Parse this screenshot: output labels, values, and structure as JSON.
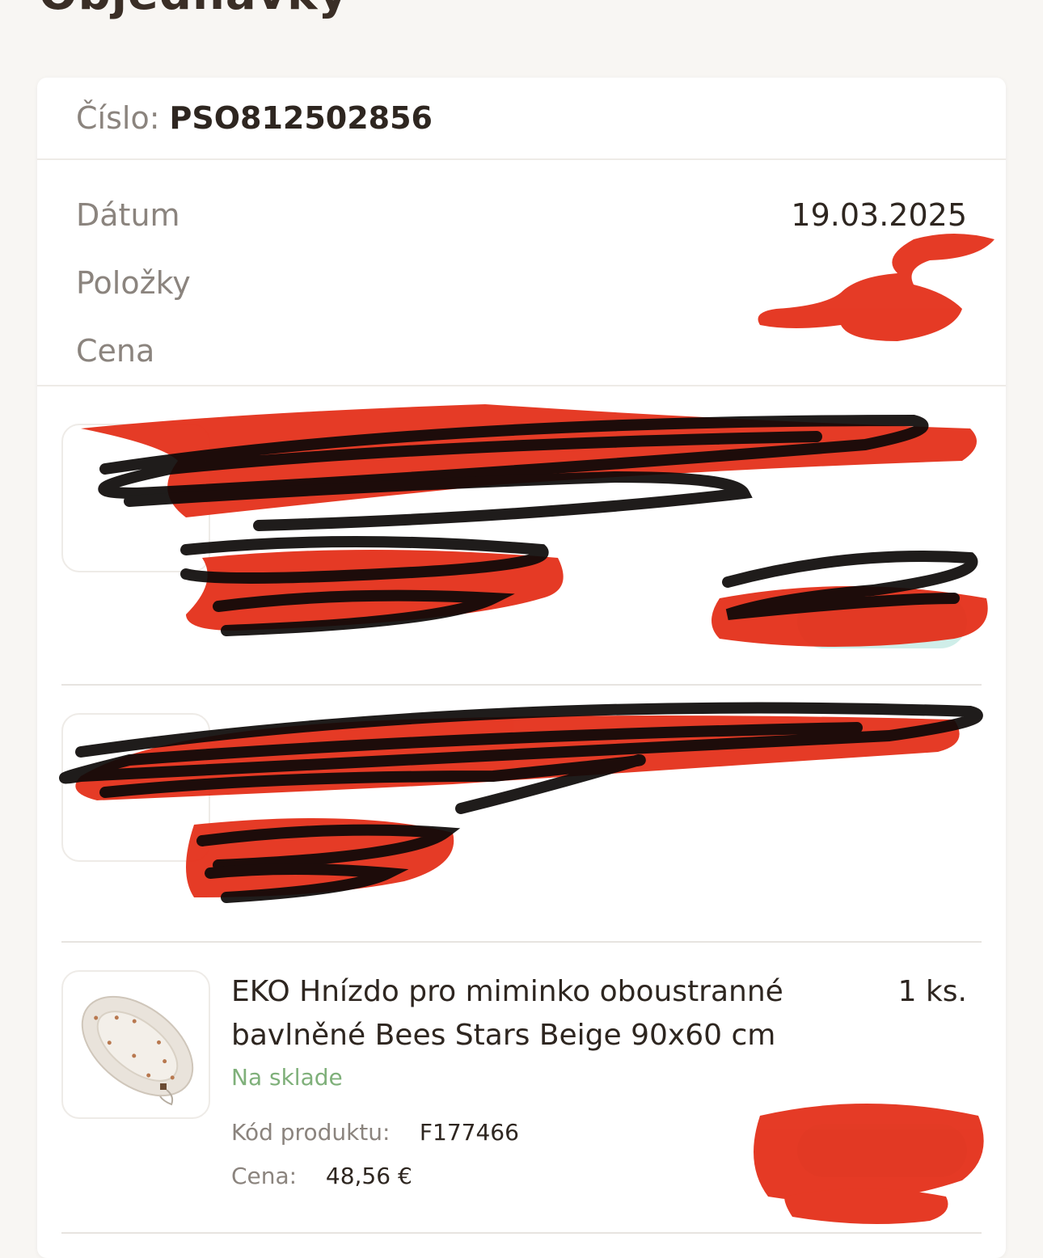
{
  "page": {
    "heading": "Objednávky"
  },
  "order": {
    "number_label": "Číslo:",
    "number": "PSO812502856",
    "date_label": "Dátum",
    "date": "19.03.2025",
    "items_label": "Položky",
    "items_value": "",
    "price_label": "Cena",
    "price_value": ""
  },
  "items": [
    {
      "name": "",
      "qty": "",
      "stock": "",
      "code_label": "",
      "code": "",
      "price_label": "",
      "price": ""
    },
    {
      "name": "",
      "qty": "",
      "stock": "",
      "code_label": "",
      "code": "",
      "price_label": "",
      "price": ""
    },
    {
      "name": "EKO Hnízdo pro miminko oboustranné bavlněné Bees Stars Beige 90x60 cm",
      "qty": "1 ks.",
      "stock": "Na sklade",
      "code_label": "Kód produktu:",
      "code": "F177466",
      "price_label": "Cena:",
      "price": "48,56 €"
    }
  ]
}
